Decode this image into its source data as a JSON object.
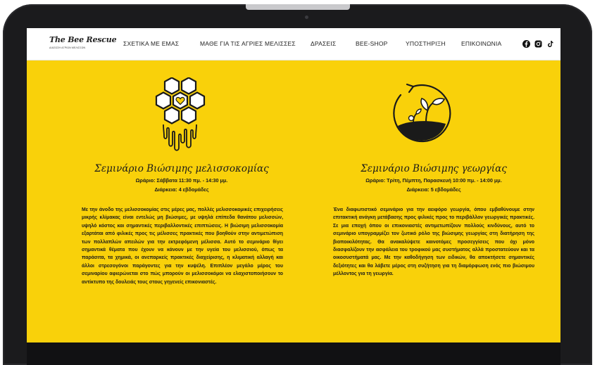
{
  "site": {
    "logo_title": "The Bee Rescue",
    "logo_subtitle": "ΔΙΑΣΩΣΗ ΑΓΡΙΩΝ ΜΕΛΙΣΣΩΝ"
  },
  "nav": {
    "items": [
      {
        "label": "ΣΧΕΤΙΚΑ ΜΕ ΕΜΑΣ"
      },
      {
        "label": "ΜΑΘΕ ΓΙΑ ΤΙΣ ΑΓΡΙΕΣ ΜΕΛΙΣΣΕΣ"
      },
      {
        "label": "ΔΡΑΣΕΙΣ"
      },
      {
        "label": "BEE-SHOP"
      },
      {
        "label": "ΥΠΟΣΤΗΡΙΞΗ"
      },
      {
        "label": "ΕΠΙΚΟΙΝΩΝΙΑ"
      }
    ],
    "social_icons": [
      "facebook-icon",
      "instagram-icon",
      "tiktok-icon"
    ]
  },
  "cards": [
    {
      "icon": "honeycomb-heart-icon",
      "title": "Σεμινάριο Βιώσιμης μελισσοκομίας",
      "schedule": "Ωράριο: Σάββατα 11:30 πμ. - 14:30 μμ.",
      "duration": "Διάρκεια: 4 εβδομάδες",
      "body": "Με την άνοδο της μελισσοκομίας στις μέρες μας, πολλές μελισσοκομικές επιχειρήσεις μικρής κλίμακας είναι εντελώς μη βιώσιμες, με υψηλά επίπεδα θανάτου μελισσών, υψηλό κόστος και σημαντικές περιβαλλοντικές επιπτώσεις. Η βιώσιμη μελισσοκομία εξαρτάται από φιλικές προς τις μέλισσες πρακτικές που βοηθούν στην αντιμετώπιση των πολλαπλών απειλών για την εκτρεφόμενη μέλισσα. Αυτό το σεμινάριο θίγει σημαντικά θέματα που έχουν να κάνουν με την υγεία του μελισσιού, όπως τα παράσιτα, τα χημικά, οι ανεπαρκείς πρακτικές διαχείρισης, η κλιματική αλλαγή και άλλοι στρεσογόνοι παράγοντες για την κυψέλη. Επιπλέον μεγάλο μέρος του σεμιναρίου αφιερώνεται στο πώς μπορούν οι μελισσοκόμοι να ελαχιστοποιήσουν το αντίκτυπο της δουλειάς τους στους γηγενείς επικονιαστές."
    },
    {
      "icon": "sprouting-plant-cycle-icon",
      "title": "Σεμινάριο Βιώσιμης γεωργίας",
      "schedule": "Ωράριο: Τρίτη, Πέμπτη, Παρασκευή 10:00 πμ. - 14:00 μμ.",
      "duration": "Διάρκεια: 5 εβδομάδες",
      "body": "Ένα διαφωτιστικό σεμινάριο για την αειφόρο γεωργία, όπου εμβαθύνουμε στην επιτακτική ανάγκη μετάβασης προς φιλικές προς το περιβάλλον γεωργικές πρακτικές. Σε μια εποχή όπου οι επικονιαστές αντιμετωπίζουν πολλούς κινδύνους, αυτό το σεμινάριο υπογραμμίζει τον ζωτικό ρόλο της βιώσιμης γεωργίας στη διατήρηση της βιοποικιλότητας. Θα ανακαλύψετε καινοτόμες προσεγγίσεις που όχι μόνο διασφαλίζουν την ασφάλεια του τροφικού μας συστήματος αλλά προστατεύουν και τα οικοσυστήματά μας. Με την καθοδήγηση των ειδικών, θα αποκτήσετε σημαντικές δεξιότητες και θα λάβετε μέρος στη συζήτηση για τη διαμόρφωση ενός πιο βιώσιμου μέλλοντος για τη γεωργία."
    }
  ],
  "colors": {
    "page_background": "#f9d10a",
    "nav_background": "#ffffff",
    "device_frame": "#1b1b1d"
  }
}
